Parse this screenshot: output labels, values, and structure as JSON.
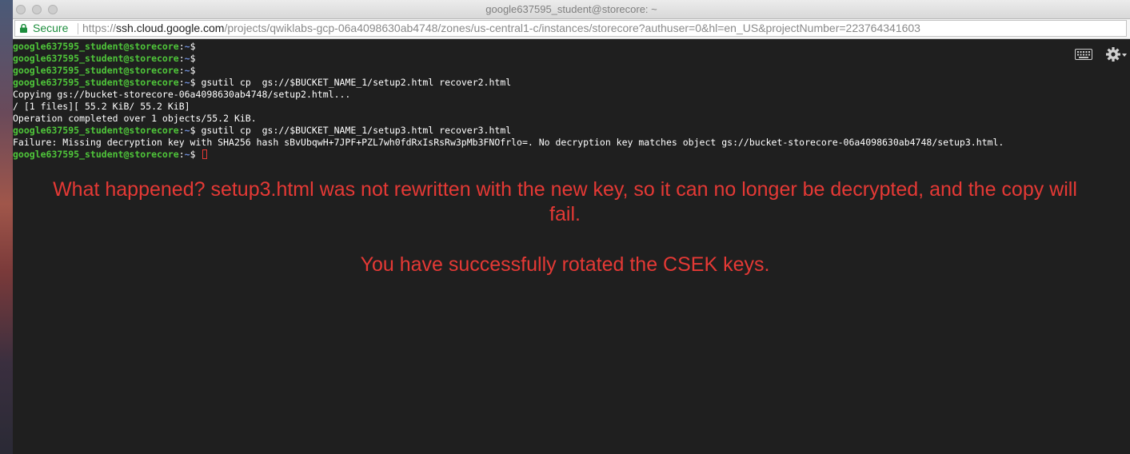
{
  "window": {
    "title": "google637595_student@storecore: ~"
  },
  "address_bar": {
    "secure_label": "Secure",
    "url_scheme": "https://",
    "url_host": "ssh.cloud.google.com",
    "url_path": "/projects/qwiklabs-gcp-06a4098630ab4748/zones/us-central1-c/instances/storecore?authuser=0&hl=en_US&projectNumber=223764341603"
  },
  "terminal": {
    "prompt_user": "google637595_student@storecore",
    "prompt_path": "~",
    "lines": [
      {
        "type": "prompt",
        "cmd": ""
      },
      {
        "type": "prompt",
        "cmd": ""
      },
      {
        "type": "prompt",
        "cmd": ""
      },
      {
        "type": "prompt",
        "cmd": " gsutil cp  gs://$BUCKET_NAME_1/setup2.html recover2.html"
      },
      {
        "type": "output",
        "text": "Copying gs://bucket-storecore-06a4098630ab4748/setup2.html..."
      },
      {
        "type": "output",
        "text": "/ [1 files][ 55.2 KiB/ 55.2 KiB]"
      },
      {
        "type": "output",
        "text": "Operation completed over 1 objects/55.2 KiB."
      },
      {
        "type": "prompt",
        "cmd": " gsutil cp  gs://$BUCKET_NAME_1/setup3.html recover3.html"
      },
      {
        "type": "output",
        "text": "Failure: Missing decryption key with SHA256 hash sBvUbqwH+7JPF+PZL7wh0fdRxIsRsRw3pMb3FNOfrlo=. No decryption key matches object gs://bucket-storecore-06a4098630ab4748/setup3.html."
      },
      {
        "type": "prompt",
        "cmd": " ",
        "cursor": true
      }
    ]
  },
  "annotation": {
    "line1": "What happened? setup3.html was not rewritten with the new key, so it can no longer be decrypted, and the copy will",
    "line2": "fail.",
    "line3": "You have successfully rotated the CSEK keys."
  },
  "icons": {
    "keyboard": "keyboard-icon",
    "settings": "gear-icon",
    "lock": "lock-icon"
  },
  "colors": {
    "prompt": "#4fc63a",
    "path": "#6f8ed8",
    "annotation": "#e53935",
    "secure": "#1e8e3e",
    "background": "#1f1f1f"
  }
}
